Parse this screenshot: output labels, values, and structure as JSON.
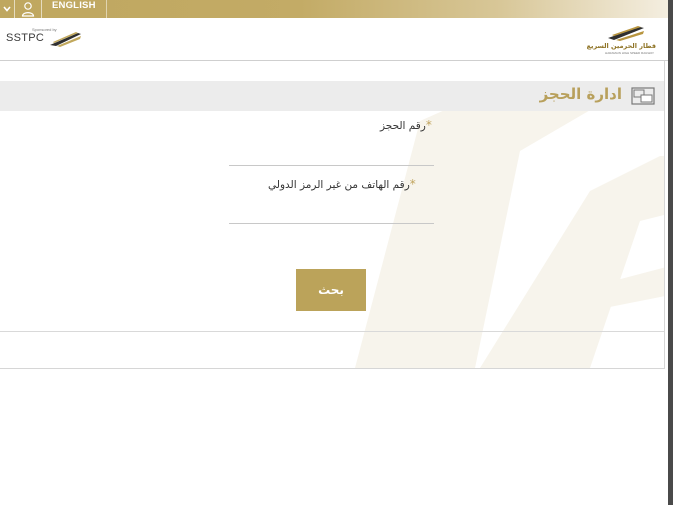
{
  "topbar": {
    "language_label": "ENGLISH",
    "chevron_icon": "chevron-down-icon",
    "user_icon": "user-icon"
  },
  "header": {
    "left_logo": {
      "small_text": "Sponsored by",
      "name": "SSTPC"
    },
    "right_logo": {
      "arabic_name": "قطار الحرمين السريع",
      "english_name": "HARAMAIN HIGH SPEED RAILWAY"
    }
  },
  "main": {
    "title": "ادارة الحجز",
    "title_icon": "screens-icon",
    "fields": [
      {
        "label": "رقم الحجز",
        "required_mark": "*",
        "value": "",
        "placeholder": ""
      },
      {
        "label": "رقم الهاتف من غير الرمز الدولي",
        "required_mark": "*",
        "value": "",
        "placeholder": ""
      }
    ],
    "search_button": "بحث"
  },
  "colors": {
    "gold": "#bba35a",
    "title_gold": "#b8a05c",
    "title_bar": "#ececec"
  }
}
